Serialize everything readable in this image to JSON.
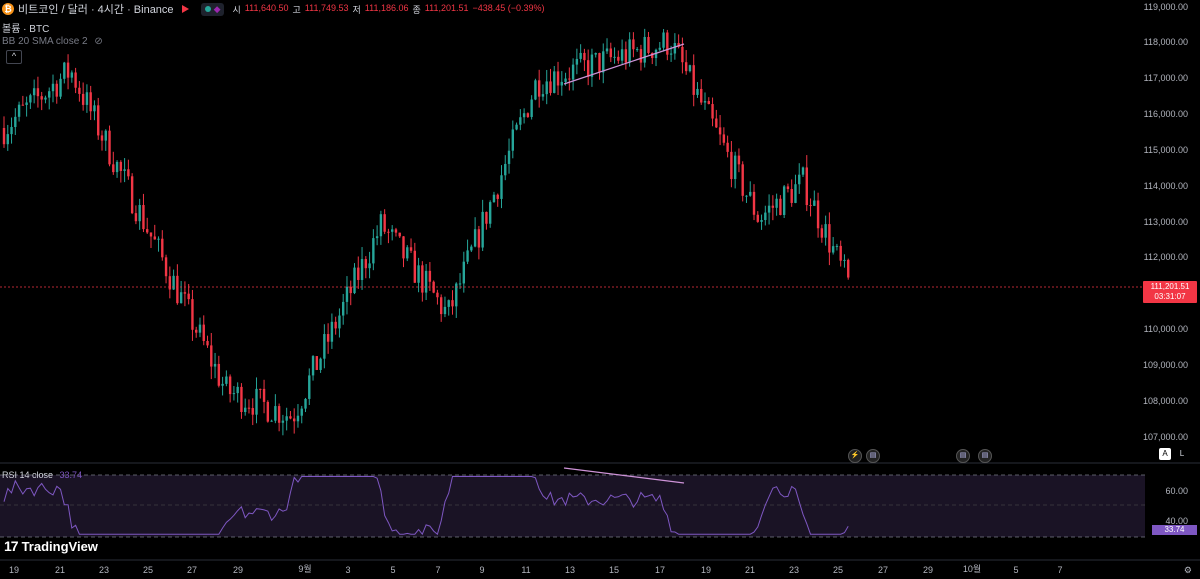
{
  "legend": {
    "coin_glyph": "₿",
    "title": "비트코인 / 달러 · 4시간 · Binance",
    "open_label": "시",
    "open": "111,640.50",
    "high_label": "고",
    "high": "111,749.53",
    "low_label": "저",
    "low": "111,186.06",
    "close_label": "종",
    "close": "111,201.51",
    "change": "−438.45 (−0.39%)"
  },
  "volume_label": "볼륨 · BTC",
  "bb_label": "BB 20 SMA close 2",
  "collapse_glyph": "^",
  "price_axis": [
    "119,000.00",
    "118,000.00",
    "117,000.00",
    "116,000.00",
    "115,000.00",
    "114,000.00",
    "113,000.00",
    "112,000.00",
    "110,000.00",
    "109,000.00",
    "108,000.00",
    "107,000.00"
  ],
  "last_price": {
    "price": "111,201.51",
    "countdown": "03:31:07"
  },
  "rsi": {
    "label": "RSI 14 close",
    "value": "33.74",
    "levels": [
      "60.00",
      "40.00"
    ]
  },
  "time_axis": [
    "19",
    "21",
    "23",
    "25",
    "27",
    "29",
    "9월",
    "3",
    "5",
    "7",
    "9",
    "11",
    "13",
    "15",
    "17",
    "19",
    "21",
    "23",
    "25",
    "27",
    "29",
    "10월",
    "5",
    "7"
  ],
  "scale_buttons": {
    "auto": "A",
    "log": "L"
  },
  "event_icons": [
    "lightning-event-icon",
    "us-flag-icon",
    "us-flag-icon",
    "us-flag-icon"
  ],
  "brand": "TradingView",
  "brand_mark": "17",
  "colors": {
    "up": "#26a69a",
    "down": "#f23645",
    "rsi": "#7e57c2",
    "trendline": "#ce93d8"
  },
  "chart_data": {
    "type": "candlestick",
    "symbol": "BTC/USD",
    "interval": "4h",
    "ylim": [
      106700,
      119200
    ],
    "key_points": [
      {
        "date": "08-19",
        "price": 115500
      },
      {
        "date": "08-22",
        "price": 117100
      },
      {
        "date": "08-29",
        "price": 108200
      },
      {
        "date": "09-01",
        "price": 107500
      },
      {
        "date": "09-05",
        "price": 112800
      },
      {
        "date": "09-08",
        "price": 110300
      },
      {
        "date": "09-12",
        "price": 116800
      },
      {
        "date": "09-18",
        "price": 117900
      },
      {
        "date": "09-22",
        "price": 113000
      },
      {
        "date": "09-24",
        "price": 114000
      },
      {
        "date": "09-26",
        "price": 111201.51
      }
    ],
    "rsi_ylim": [
      30,
      70
    ]
  }
}
